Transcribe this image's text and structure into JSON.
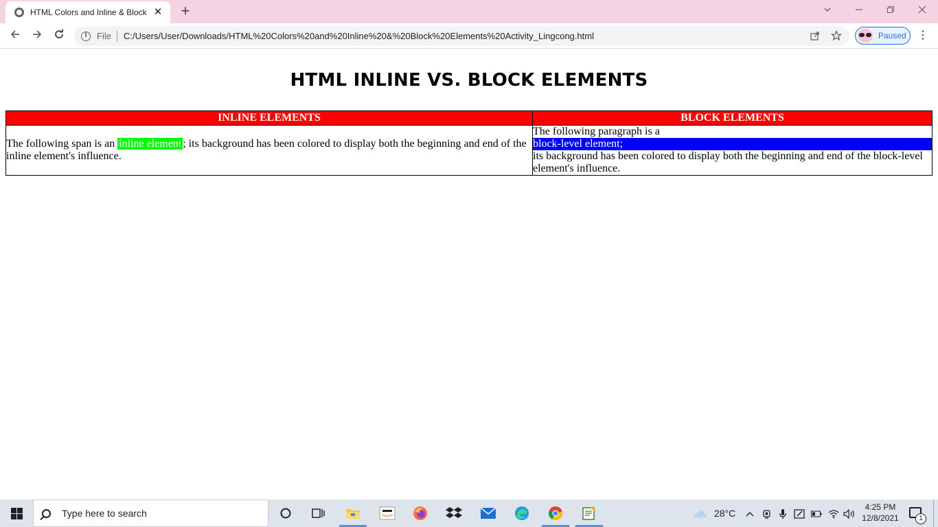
{
  "browser": {
    "tab_title": "HTML Colors and Inline & Block Elements Activity",
    "tab_close": "✕",
    "new_tab": "+",
    "scheme_label": "File",
    "url": "C:/Users/User/Downloads/HTML%20Colors%20and%20Inline%20&%20Block%20Elements%20Activity_Lingcong.html",
    "profile_label": "Paused",
    "icons": [
      "back-icon",
      "forward-icon",
      "reload-icon",
      "info-icon",
      "share-icon",
      "star-icon",
      "menu-icon"
    ]
  },
  "page": {
    "heading": "HTML INLINE VS. BLOCK ELEMENTS",
    "table": {
      "headers": [
        "INLINE ELEMENTS",
        "BLOCK ELEMENTS"
      ],
      "inline_cell": {
        "before": "The following span is an ",
        "highlight": "inline element",
        "after": "; its background has been colored to display both the beginning and end of the inline element's influence."
      },
      "block_cell": {
        "before": "The following paragraph is a",
        "highlight": "block-level element;",
        "after": "its background has been colored to display both the beginning and end of the block-level element's influence."
      }
    },
    "colors": {
      "header_bg": "#ff0000",
      "inline_highlight_bg": "#00ff00",
      "block_highlight_bg": "#0000ff"
    }
  },
  "taskbar": {
    "search_placeholder": "Type here to search",
    "weather": "28°C",
    "time": "4:25 PM",
    "date": "12/8/2021",
    "notification_count": "1"
  }
}
